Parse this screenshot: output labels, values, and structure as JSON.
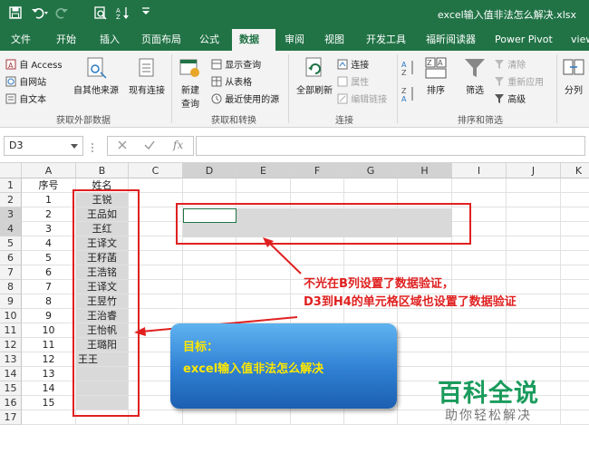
{
  "window": {
    "title": "excel输入值非法怎么解决.xlsx",
    "quick_access": [
      "save-icon",
      "undo-icon",
      "redo-icon",
      "print-preview-icon",
      "sort-icon",
      "customize-icon"
    ]
  },
  "tabs": [
    "文件",
    "开始",
    "插入",
    "页面布局",
    "公式",
    "数据",
    "审阅",
    "视图",
    "开发工具",
    "福昕阅读器",
    "Power Pivot",
    "view"
  ],
  "active_tab": "数据",
  "ribbon": {
    "get_external": {
      "access": "自 Access",
      "web": "自网站",
      "text": "自文本",
      "other": "自其他来源",
      "existing": "现有连接",
      "group": "获取外部数据"
    },
    "transform": {
      "new_query": "新建",
      "new_query2": "查询",
      "show_query": "显示查询",
      "from_table": "从表格",
      "recent": "最近使用的源",
      "group": "获取和转换"
    },
    "connections": {
      "refresh": "全部刷新",
      "connect": "连接",
      "properties": "属性",
      "edit_links": "编辑链接",
      "group": "连接"
    },
    "sort_filter": {
      "sort": "排序",
      "filter": "筛选",
      "clear": "清除",
      "reapply": "重新应用",
      "advanced": "高级",
      "group": "排序和筛选"
    },
    "split": "分列"
  },
  "formula_bar": {
    "name_box": "D3",
    "fx": "fx",
    "value": ""
  },
  "columns": [
    "A",
    "B",
    "C",
    "D",
    "E",
    "F",
    "G",
    "H",
    "I",
    "J",
    "K"
  ],
  "rows": [
    {
      "n": "1",
      "a": "序号",
      "b": "姓名"
    },
    {
      "n": "2",
      "a": "1",
      "b": "王锐"
    },
    {
      "n": "3",
      "a": "2",
      "b": "王品如"
    },
    {
      "n": "4",
      "a": "3",
      "b": "王红"
    },
    {
      "n": "5",
      "a": "4",
      "b": "王译文"
    },
    {
      "n": "6",
      "a": "5",
      "b": "王籽菡"
    },
    {
      "n": "7",
      "a": "6",
      "b": "王浩铭"
    },
    {
      "n": "8",
      "a": "7",
      "b": "王译文"
    },
    {
      "n": "9",
      "a": "8",
      "b": "王昱竹"
    },
    {
      "n": "10",
      "a": "9",
      "b": "王治睿"
    },
    {
      "n": "11",
      "a": "10",
      "b": "王怡帆"
    },
    {
      "n": "12",
      "a": "11",
      "b": "王璐阳"
    },
    {
      "n": "13",
      "a": "12",
      "b": ""
    },
    {
      "n": "14",
      "a": "13",
      "b": ""
    },
    {
      "n": "15",
      "a": "14",
      "b": ""
    },
    {
      "n": "16",
      "a": "15",
      "b": ""
    },
    {
      "n": "17",
      "a": "",
      "b": ""
    }
  ],
  "a13_overflow": "王王",
  "annotation": {
    "line1": "不光在B列设置了数据验证，",
    "line2": "D3到H4的单元格区域也设置了数据验证"
  },
  "goal": {
    "line1": "目标：",
    "line2": "excel输入值非法怎么解决"
  },
  "watermark": {
    "brand": "百科全说",
    "tagline": "助你轻松解决"
  },
  "colors": {
    "excel_green": "#217346",
    "annotation_red": "#e02020",
    "goal_text": "#ffe800",
    "watermark_green": "#1a9b5c"
  }
}
